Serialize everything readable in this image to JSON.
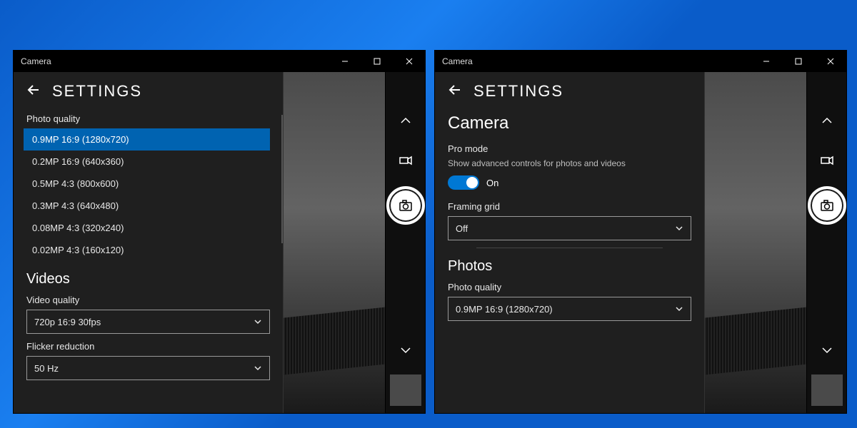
{
  "window": {
    "title": "Camera"
  },
  "settings_title": "SETTINGS",
  "left": {
    "photo_quality_label": "Photo quality",
    "photo_quality_options": [
      "0.9MP 16:9 (1280x720)",
      "0.2MP 16:9 (640x360)",
      "0.5MP 4:3 (800x600)",
      "0.3MP 4:3 (640x480)",
      "0.08MP 4:3 (320x240)",
      "0.02MP 4:3 (160x120)"
    ],
    "videos_heading": "Videos",
    "video_quality_label": "Video quality",
    "video_quality_value": "720p 16:9 30fps",
    "flicker_label": "Flicker reduction",
    "flicker_value": "50 Hz"
  },
  "right": {
    "camera_heading": "Camera",
    "pro_mode_label": "Pro mode",
    "pro_mode_desc": "Show advanced controls for photos and videos",
    "pro_mode_state": "On",
    "framing_grid_label": "Framing grid",
    "framing_grid_value": "Off",
    "photos_heading": "Photos",
    "photo_quality_label": "Photo quality",
    "photo_quality_value": "0.9MP 16:9 (1280x720)"
  }
}
